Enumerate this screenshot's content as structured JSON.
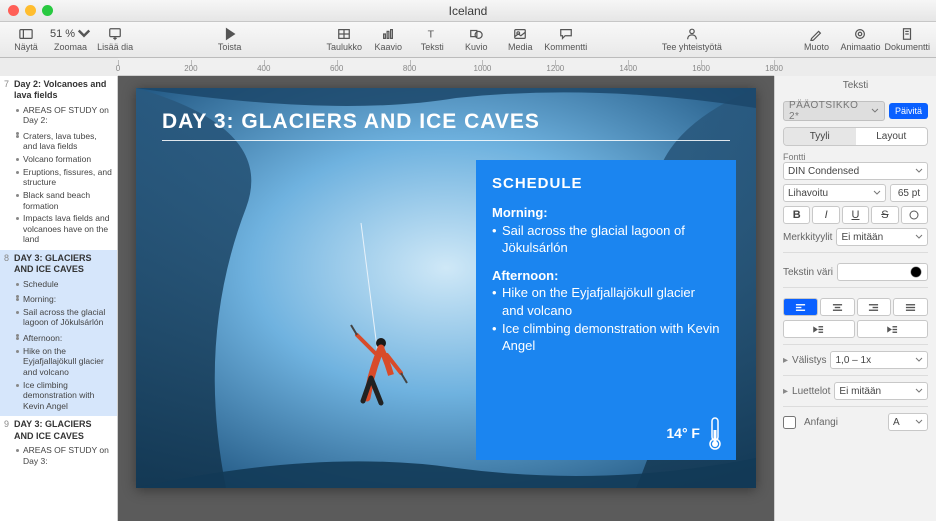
{
  "window": {
    "title": "Iceland"
  },
  "toolbar": {
    "view": "Näytä",
    "zoom": "Zoomaa",
    "zoom_value": "51 %",
    "add_slide": "Lisää dia",
    "play": "Toista",
    "table": "Taulukko",
    "chart": "Kaavio",
    "text": "Teksti",
    "shape": "Kuvio",
    "media": "Media",
    "comment": "Kommentti",
    "collaborate": "Tee yhteistyötä",
    "format": "Muoto",
    "animate": "Animaatio",
    "document": "Dokumentti"
  },
  "ruler_ticks": [
    "0",
    "200",
    "400",
    "600",
    "800",
    "1000",
    "1200",
    "1400",
    "1600",
    "1800"
  ],
  "outline": {
    "slides": [
      {
        "num": "7",
        "title": "Day 2: Volcanoes and lava fields",
        "selected": false,
        "items": [
          "AREAS OF STUDY on Day 2:",
          "",
          "Craters, lava tubes, and lava fields",
          "Volcano formation",
          "Eruptions, fissures, and structure",
          "Black sand beach formation",
          "Impacts lava fields and volcanoes have on the land"
        ]
      },
      {
        "num": "8",
        "title": "DAY 3: GLACIERS AND ICE CAVES",
        "selected": true,
        "items": [
          "Schedule",
          "",
          "Morning:",
          "Sail across the glacial lagoon of Jökulsárlón",
          "",
          "Afternoon:",
          "Hike on the Eyjafjallajökull glacier and volcano",
          "Ice climbing demonstration with Kevin Angel"
        ]
      },
      {
        "num": "9",
        "title": "DAY 3: GLACIERS AND ICE CAVES",
        "selected": false,
        "items": [
          "AREAS OF STUDY on Day 3:"
        ]
      }
    ]
  },
  "slide": {
    "title": "DAY 3: GLACIERS AND ICE CAVES",
    "schedule_heading": "SCHEDULE",
    "morning_label": "Morning:",
    "morning_items": [
      "Sail across the glacial lagoon of Jökulsárlón"
    ],
    "afternoon_label": "Afternoon:",
    "afternoon_items": [
      "Hike on the Eyjafjallajökull glacier and volcano",
      "Ice climbing demonstration with Kevin Angel"
    ],
    "temperature": "14° F"
  },
  "inspector": {
    "header": "Teksti",
    "paragraph_style": "PÄÄOTSIKKO 2*",
    "update": "Päivitä",
    "tab_style": "Tyyli",
    "tab_layout": "Layout",
    "font_label": "Fontti",
    "font_family": "DIN Condensed",
    "font_weight": "Lihavoitu",
    "font_size": "65 pt",
    "char_styles_label": "Merkkityylit",
    "char_styles_value": "Ei mitään",
    "text_color_label": "Tekstin väri",
    "spacing_label": "Välistys",
    "spacing_value": "1,0 – 1x",
    "lists_label": "Luettelot",
    "lists_value": "Ei mitään",
    "dropcap_label": "Anfangi"
  }
}
